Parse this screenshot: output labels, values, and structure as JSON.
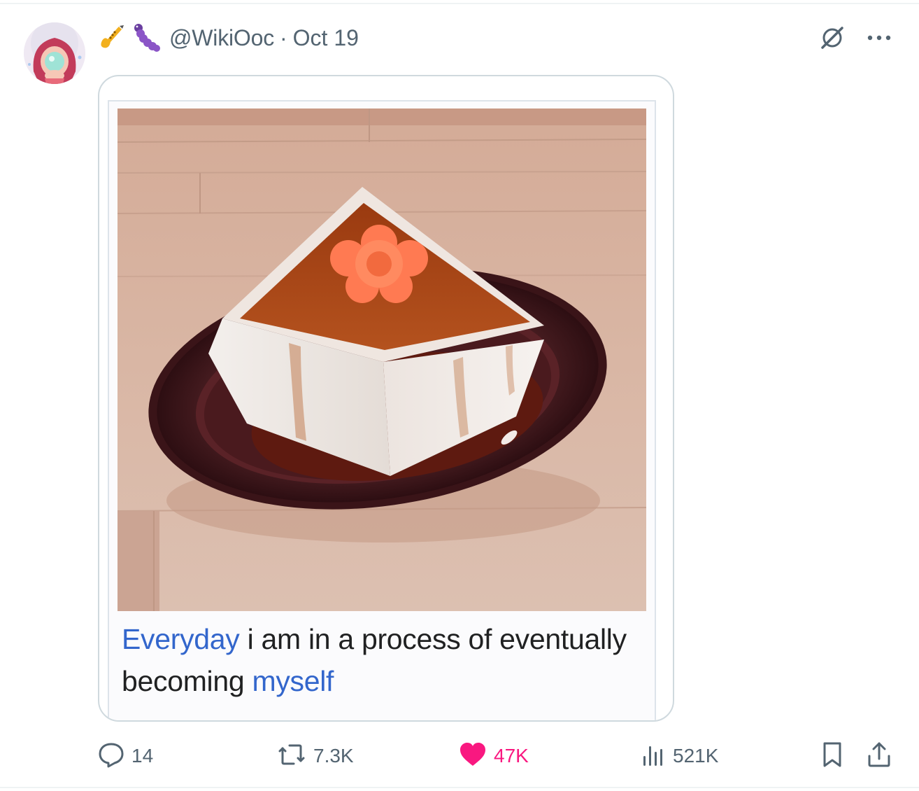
{
  "post": {
    "handle": "@WikiOoc",
    "separator": "·",
    "date": "Oct 19",
    "name_emojis": [
      "saxophone-icon",
      "caterpillar-icon"
    ]
  },
  "media": {
    "caption_parts": [
      {
        "text": "Everyday",
        "link": true
      },
      {
        "text": " i am in a process of eventually becoming ",
        "link": false
      },
      {
        "text": "myself",
        "link": true
      }
    ],
    "colors": {
      "link": "#3366cc",
      "text": "#202122"
    }
  },
  "actions": {
    "replies": "14",
    "reposts": "7.3K",
    "likes": "47K",
    "views": "521K"
  },
  "colors": {
    "muted": "#536471",
    "like": "#f91880",
    "border": "#cfd9de"
  }
}
